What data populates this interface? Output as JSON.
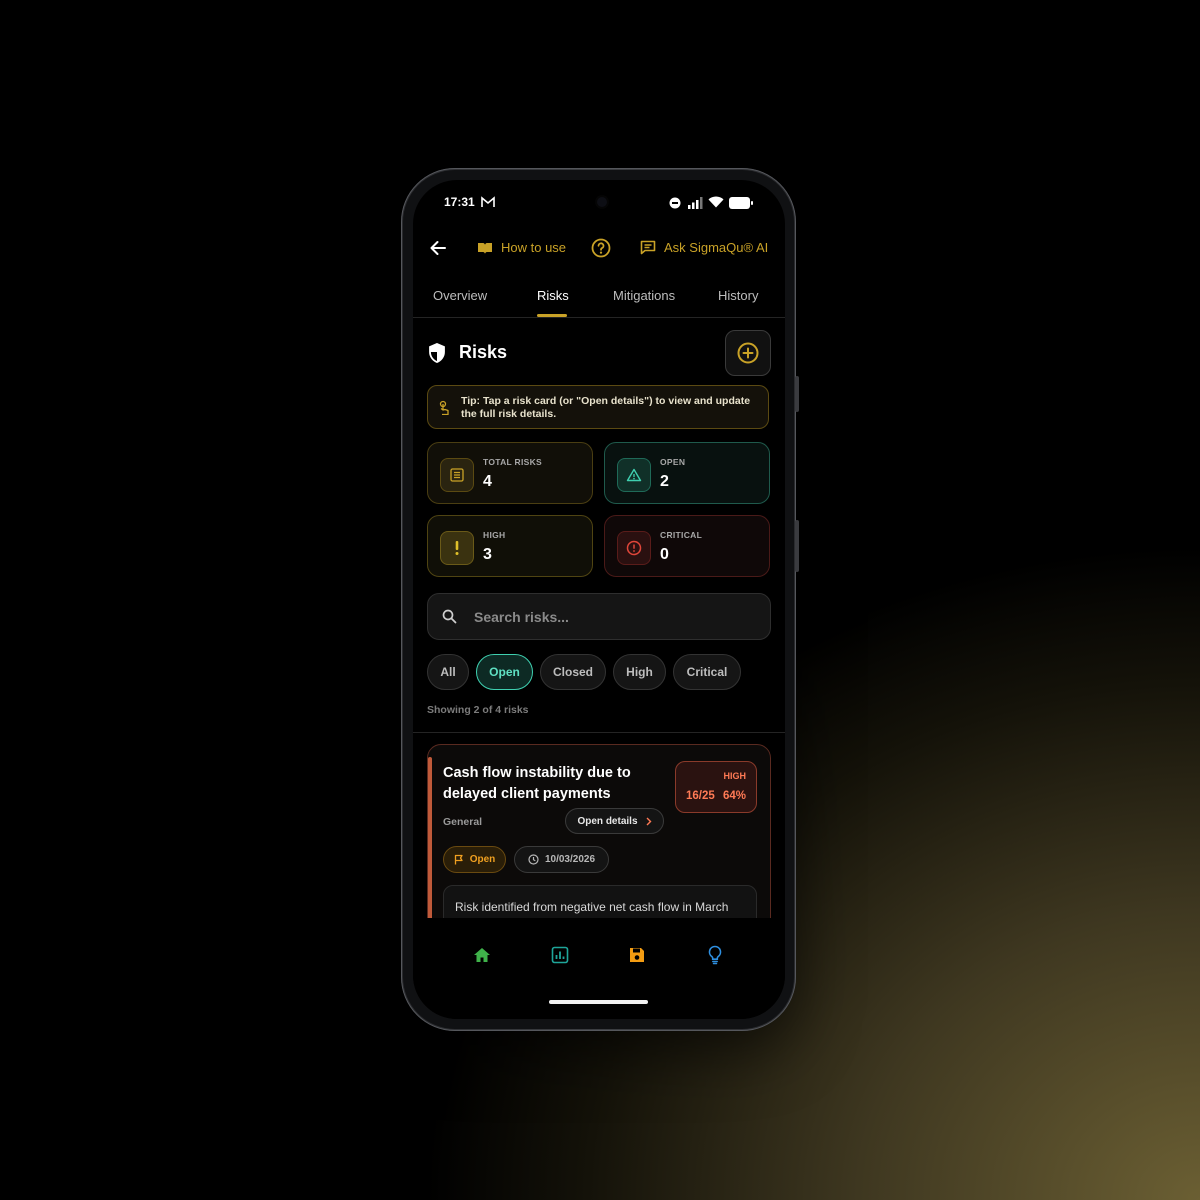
{
  "status_bar": {
    "time": "17:31"
  },
  "header": {
    "back_label": "Back",
    "how_to_use": "How to use",
    "ask_ai": "Ask SigmaQu® AI"
  },
  "tabs": [
    {
      "label": "Overview",
      "active": false
    },
    {
      "label": "Risks",
      "active": true
    },
    {
      "label": "Mitigations",
      "active": false
    },
    {
      "label": "History",
      "active": false
    }
  ],
  "page": {
    "title": "Risks"
  },
  "tip": {
    "text": "Tip: Tap a risk card (or \"Open details\") to view and update the full risk details."
  },
  "stats": [
    {
      "label": "TOTAL RISKS",
      "value": "4",
      "color": "#c9a227"
    },
    {
      "label": "OPEN",
      "value": "2",
      "color": "#3fd0b0"
    },
    {
      "label": "HIGH",
      "value": "3",
      "color": "#e0c12a"
    },
    {
      "label": "CRITICAL",
      "value": "0",
      "color": "#e0463a"
    }
  ],
  "search": {
    "placeholder": "Search risks..."
  },
  "filters": [
    {
      "label": "All",
      "active": false
    },
    {
      "label": "Open",
      "active": true
    },
    {
      "label": "Closed",
      "active": false
    },
    {
      "label": "High",
      "active": false
    },
    {
      "label": "Critical",
      "active": false
    }
  ],
  "showing_text": "Showing 2 of 4 risks",
  "risk_card": {
    "title": "Cash flow instability due to delayed client payments",
    "severity_label": "HIGH",
    "score": "16/25",
    "percent": "64%",
    "category": "General",
    "open_details": "Open details",
    "status": "Open",
    "date": "10/03/2026",
    "description": "Risk identified from negative net cash flow in March"
  },
  "bottom_nav": [
    "home-icon",
    "chart-icon",
    "save-icon",
    "lightbulb-icon"
  ],
  "colors": {
    "accent": "#c9a227",
    "teal": "#3fd0b0",
    "high": "#ff7a55",
    "critical": "#e0463a"
  }
}
